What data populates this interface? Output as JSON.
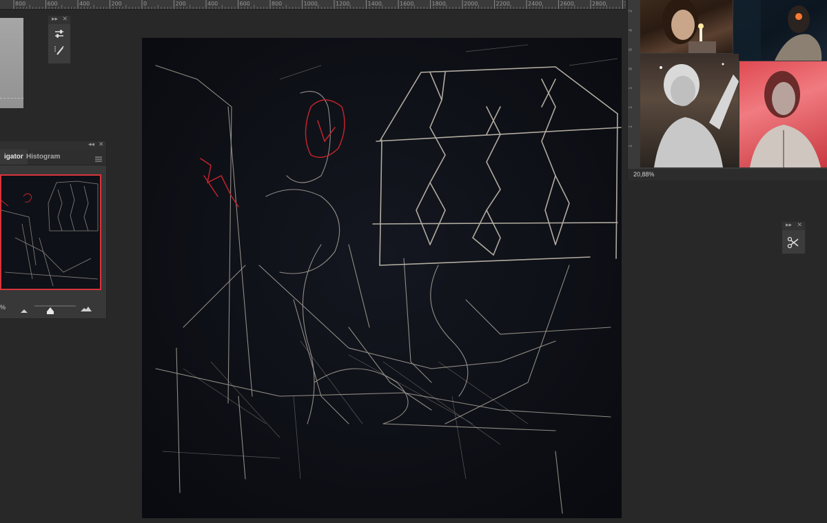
{
  "ruler": {
    "labels": [
      "800",
      "600",
      "400",
      "200",
      "0",
      "200",
      "400",
      "600",
      "800",
      "1000",
      "1200",
      "1400",
      "1600",
      "1800",
      "2000",
      "2200",
      "2400",
      "2600",
      "2800",
      "3"
    ]
  },
  "navigator": {
    "tabs": [
      "Navigator",
      "Histogram"
    ],
    "active_tab_visible_text": "igator",
    "zoom_text": "%"
  },
  "reference": {
    "ruler_labels": [
      "2",
      "4",
      "6",
      "8",
      "1",
      "1",
      "1",
      "1"
    ],
    "status_zoom": "20,88%",
    "photos": [
      "woman-lighting-cigarette",
      "man-with-cigarette-dark",
      "woman-statue-grey",
      "woman-statue-red-backlit"
    ]
  },
  "icons": {
    "panel1": [
      "adjustments-icon",
      "brush-presets-icon"
    ],
    "panel2": [
      "tool-scissors-icon"
    ]
  },
  "colors": {
    "app_bg": "#282828",
    "panel_bg": "#383838",
    "canvas_bg": "#0d0f16",
    "highlight_red": "#d8343b"
  }
}
